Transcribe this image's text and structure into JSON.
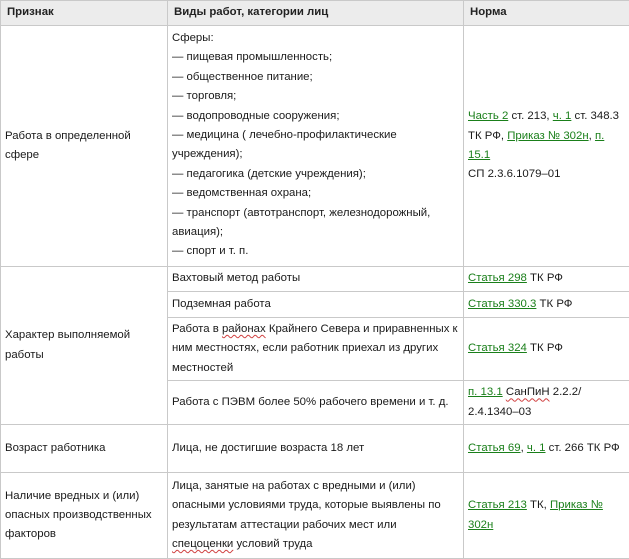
{
  "header": {
    "col1": "Признак",
    "col2": "Виды работ,  категории лиц",
    "col3": "Норма"
  },
  "row1": {
    "sign": "Работа в определенной сфере",
    "lines": [
      "Сферы:",
      "— пищевая промышленность;",
      "— общественное питание;",
      "— торговля;",
      "— водопроводные сооружения;",
      "— медицина ( лечебно-профилактические учреждения);",
      "— педагогика (детские учреждения);",
      "— ведомственная охрана;",
      "— транспорт (автотранспорт, железнодорожный, авиация);",
      "— спорт и т. п."
    ],
    "norm": {
      "link1": "Часть 2",
      "t1": " ст. 213, ",
      "link2": "ч. 1",
      "t2": " ст. 348.3 ТК РФ, ",
      "link3": "Приказ № 302н",
      "t3": ", ",
      "link4": "п. 15.1",
      "t4": "СП 2.3.6.1079–01"
    }
  },
  "row2": {
    "sign": "Характер выполняемой работы",
    "subrows": [
      {
        "work": "Вахтовый метод работы",
        "link": "Статья 298",
        "rest": " ТК РФ"
      },
      {
        "work": "Подземная работа",
        "link": "Статья 330.3",
        "rest": " ТК РФ"
      },
      {
        "work_a": "Работа в ",
        "work_b": "районах",
        "work_c": " Крайнего Севера и приравненных к ним местностях, если работник приехал из других местностей",
        "link": "Статья 324",
        "rest": " ТК РФ"
      },
      {
        "work": "Работа с ПЭВМ более 50% рабочего времени и т. д.",
        "link": "п. 13.1",
        "rest_a": " ",
        "rest_b": "СанПиН",
        "rest_c": " 2.2.2/ 2.4.1340–03"
      }
    ]
  },
  "row3": {
    "sign": "Возраст работника",
    "work": "Лица, не достигшие возраста 18 лет",
    "link1": "Статья 69",
    "t1": ", ",
    "link2": "ч. 1",
    "t2": " ст. 266 ТК РФ"
  },
  "row4": {
    "sign": "Наличие вредных и (или) опасных производственных факторов",
    "work_a": "Лица, занятые на работах с вредными и (или) опасными условиями труда, которые выявлены по результатам аттестации рабочих мест или ",
    "work_b": "спецоценки",
    "work_c": " условий труда",
    "link1": "Статья 213",
    "t1": " ТК, ",
    "link2": "Приказ № 302н"
  }
}
